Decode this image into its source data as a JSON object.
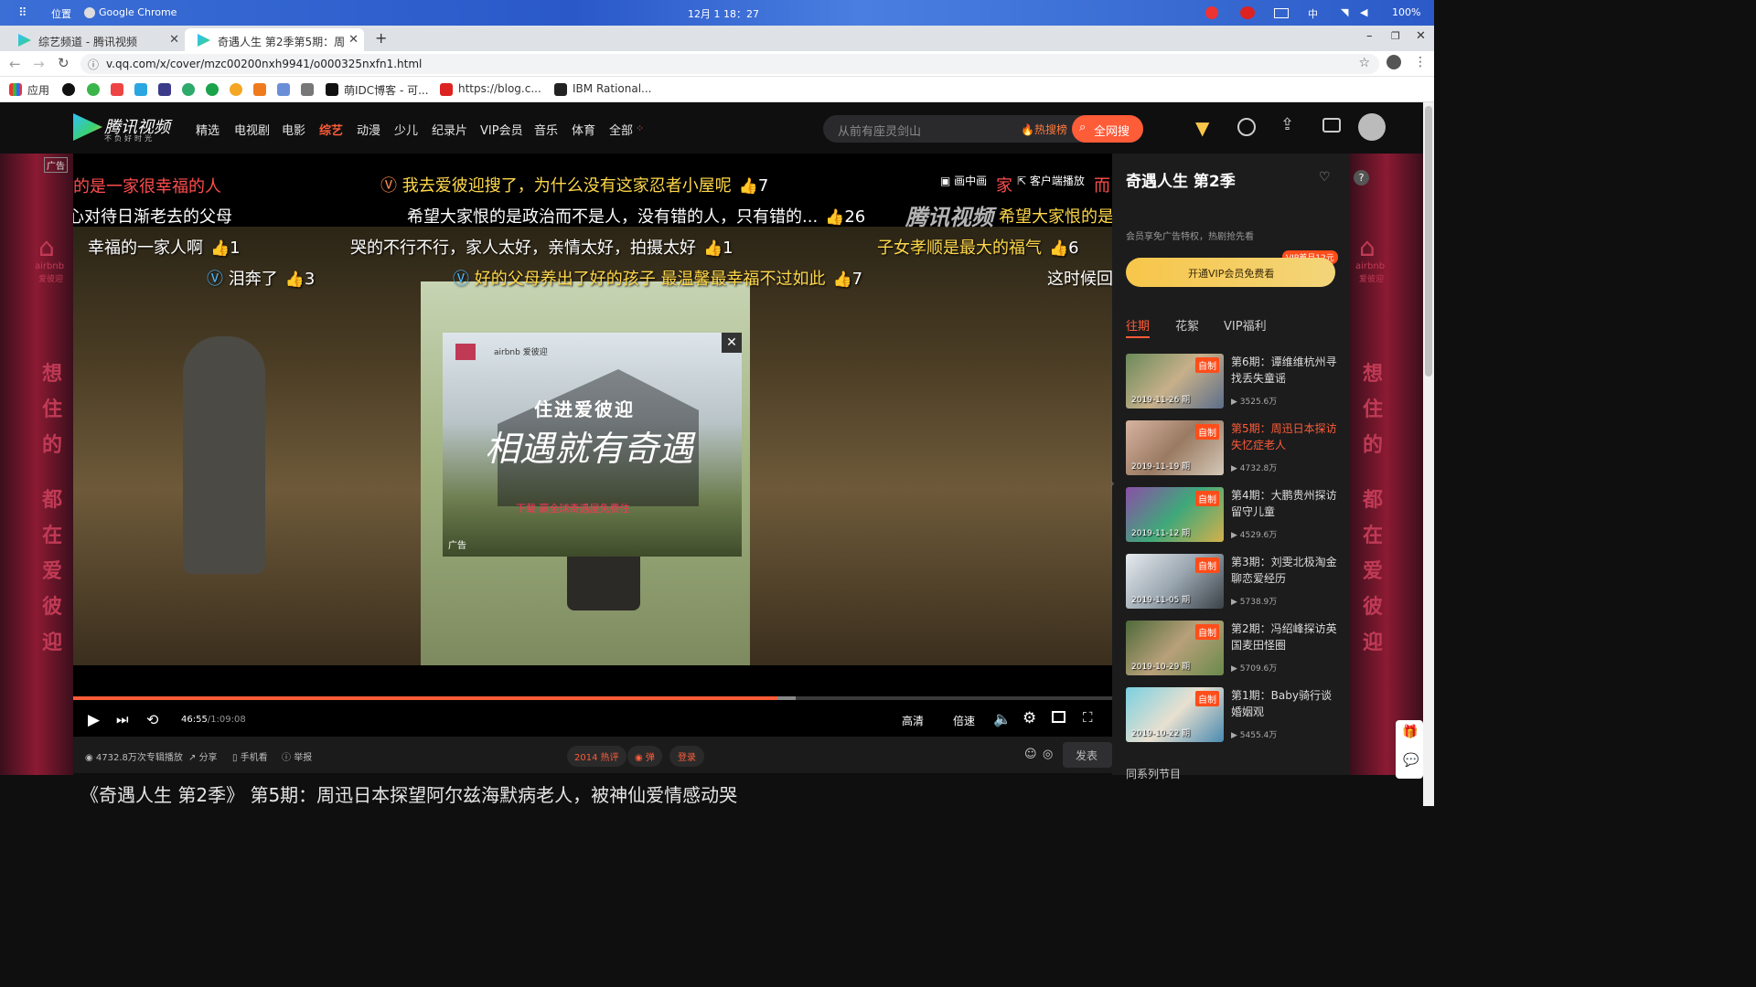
{
  "os": {
    "apps_label": "位置",
    "app_name": "Google Chrome",
    "clock": "12月 1 18：27",
    "battery": "100%",
    "ime": "中"
  },
  "browser": {
    "tabs": [
      {
        "label": "综艺频道 - 腾讯视频"
      },
      {
        "label": "奇遇人生 第2季第5期：周"
      }
    ],
    "url": "v.qq.com/x/cover/mzc00200nxh9941/o000325nxfn1.html",
    "bookmarks": [
      "应用",
      "萌IDC博客 - 可...",
      "https://blog.c...",
      "IBM Rational..."
    ]
  },
  "site": {
    "logo": "腾讯视频",
    "slogan": "不负好时光",
    "nav": [
      "精选",
      "电视剧",
      "电影",
      "综艺",
      "动漫",
      "少儿",
      "纪录片",
      "VIP会员",
      "音乐",
      "体育",
      "全部"
    ],
    "search_placeholder": "从前有座灵剑山",
    "hot_label": "热搜榜",
    "search_button": "全网搜"
  },
  "player": {
    "ad_tag": "广告",
    "pip_label": "画中画",
    "client_label": "客户端播放",
    "watermark": "腾讯视频",
    "time_current": "46:55",
    "time_total": "/1:09:08",
    "progress_played": 0.678,
    "progress_buffered": 0.695,
    "quality": "高清",
    "speed": "倍速"
  },
  "danmaku": [
    {
      "text": "的是一家很幸福的人"
    },
    {
      "text": "我去爱彼迎搜了，为什么没有这家忍者小屋呢",
      "likes": "7"
    },
    {
      "text": "心对待日渐老去的父母"
    },
    {
      "text": "希望大家恨的是政治而不是人，没有错的人，只有错的...",
      "likes": "26"
    },
    {
      "text": "希望大家恨的是"
    },
    {
      "text": "幸福的一家人啊",
      "likes": "1"
    },
    {
      "text": "哭的不行不行，家人太好，亲情太好，拍摄太好",
      "likes": "1"
    },
    {
      "text": "子女孝顺是最大的福气",
      "likes": "6"
    },
    {
      "text": "泪奔了",
      "likes": "3"
    },
    {
      "text": "好的父母养出了好的孩子 最温馨最幸福不过如此",
      "likes": "7"
    },
    {
      "text": "这时候回"
    },
    {
      "text": "家"
    },
    {
      "text": "而"
    }
  ],
  "ad": {
    "headline": "住进爱彼迎",
    "script": "相遇就有奇遇",
    "cta": "下载 赢全球奇遇屋免费住",
    "label": "广告",
    "brand": "airbnb 爱彼迎"
  },
  "below": {
    "plays": "4732.8万次专辑播放",
    "share": "分享",
    "mobile": "手机看",
    "report": "举报",
    "hot_review": "2014 热评",
    "danmaku_toggle": "弹",
    "login": "登录",
    "send": "发表"
  },
  "side_banner": {
    "brand": "airbnb",
    "brand_cn": "爱彼迎",
    "slogan": [
      "想",
      "住",
      "的",
      "都",
      "在",
      "爱",
      "彼",
      "迎"
    ]
  },
  "sidebar": {
    "title": "奇遇人生 第2季",
    "vip_note": "会员享免广告特权，热剧抢先看",
    "vip_badge": "VIP首月12元",
    "vip_button": "开通VIP会员免费看",
    "tabs": [
      "往期",
      "花絮",
      "VIP福利"
    ],
    "episodes": [
      {
        "title": "第6期：谭维维杭州寻找丢失童谣",
        "date": "2019-11-26 期",
        "views": "3525.6万",
        "badge": "自制"
      },
      {
        "title": "第5期：周迅日本探访失忆症老人",
        "date": "2019-11-19 期",
        "views": "4732.8万",
        "badge": "自制"
      },
      {
        "title": "第4期：大鹏贵州探访留守儿童",
        "date": "2019-11-12 期",
        "views": "4529.6万",
        "badge": "自制"
      },
      {
        "title": "第3期：刘雯北极淘金聊恋爱经历",
        "date": "2019-11-05 期",
        "views": "5738.9万",
        "badge": "自制"
      },
      {
        "title": "第2期：冯绍峰探访英国麦田怪圈",
        "date": "2019-10-29 期",
        "views": "5709.6万",
        "badge": "自制"
      },
      {
        "title": "第1期：Baby骑行谈婚姻观",
        "date": "2019-10-22 期",
        "views": "5455.4万",
        "badge": "自制"
      }
    ],
    "section_more": "同系列节目"
  },
  "page_title": "《奇遇人生 第2季》 第5期：周迅日本探望阿尔兹海默病老人，被神仙爱情感动哭",
  "colors": {
    "accent": "#ff5c38",
    "danmaku_yellow": "#ffd84a",
    "vip_gold": "#f7c64a"
  }
}
